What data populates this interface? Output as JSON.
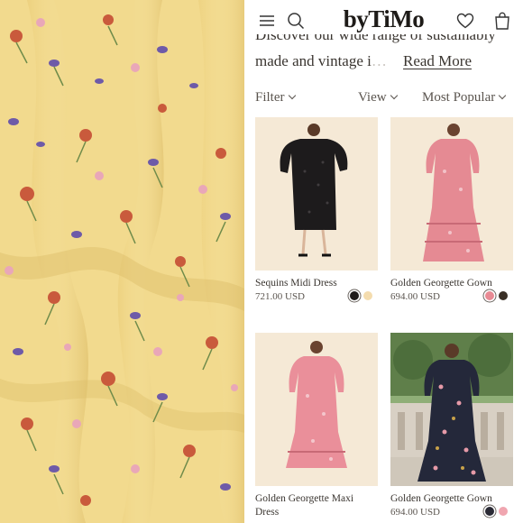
{
  "header": {
    "brand": "byTiMo",
    "icons": [
      "menu-icon",
      "search-icon",
      "heart-icon",
      "bag-icon"
    ]
  },
  "intro": {
    "line1": "Discover our wide range of sustainably",
    "line2": "made and vintage i",
    "read_more": "Read More"
  },
  "toolbar": {
    "filter_label": "Filter",
    "view_label": "View",
    "sort_label": "Most Popular"
  },
  "products": [
    {
      "name": "Sequins Midi Dress",
      "price": "721.00 USD",
      "swatches": [
        "#1f1c1b",
        "#f4dcae"
      ]
    },
    {
      "name": "Golden Georgette Gown",
      "price": "694.00 USD",
      "swatches": [
        "#e88a94",
        "#3a2f26"
      ]
    },
    {
      "name": "Golden Georgette Maxi Dress",
      "price": "",
      "swatches": []
    },
    {
      "name": "Golden Georgette Gown",
      "price": "694.00 USD",
      "swatches": [
        "#2a2a35",
        "#f0a6b0"
      ]
    }
  ],
  "colors": {
    "fabric_base": "#f1d98a",
    "accent_text": "#2a2520",
    "card_bg": "#f6ead8"
  }
}
